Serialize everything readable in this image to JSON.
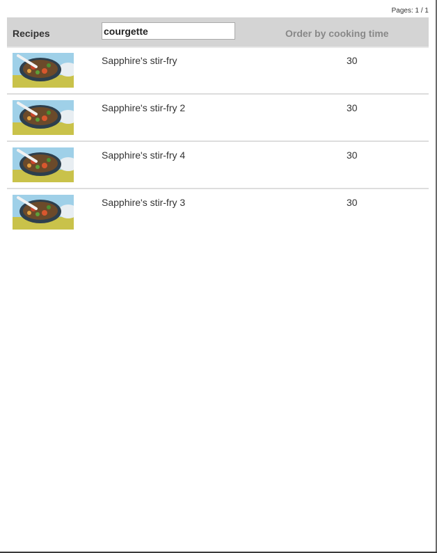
{
  "pagination": {
    "label": "Pages: 1 / 1"
  },
  "header": {
    "title": "Recipes",
    "search_value": "courgette",
    "order_label": "Order by cooking time"
  },
  "recipes": [
    {
      "name": "Sapphire's stir-fry",
      "cooking_time": "30",
      "image": "stir-fry-pan-photo"
    },
    {
      "name": "Sapphire's stir-fry 2",
      "cooking_time": "30",
      "image": "stir-fry-pan-photo"
    },
    {
      "name": "Sapphire's stir-fry 4",
      "cooking_time": "30",
      "image": "stir-fry-pan-photo"
    },
    {
      "name": "Sapphire's stir-fry 3",
      "cooking_time": "30",
      "image": "stir-fry-pan-photo"
    }
  ]
}
